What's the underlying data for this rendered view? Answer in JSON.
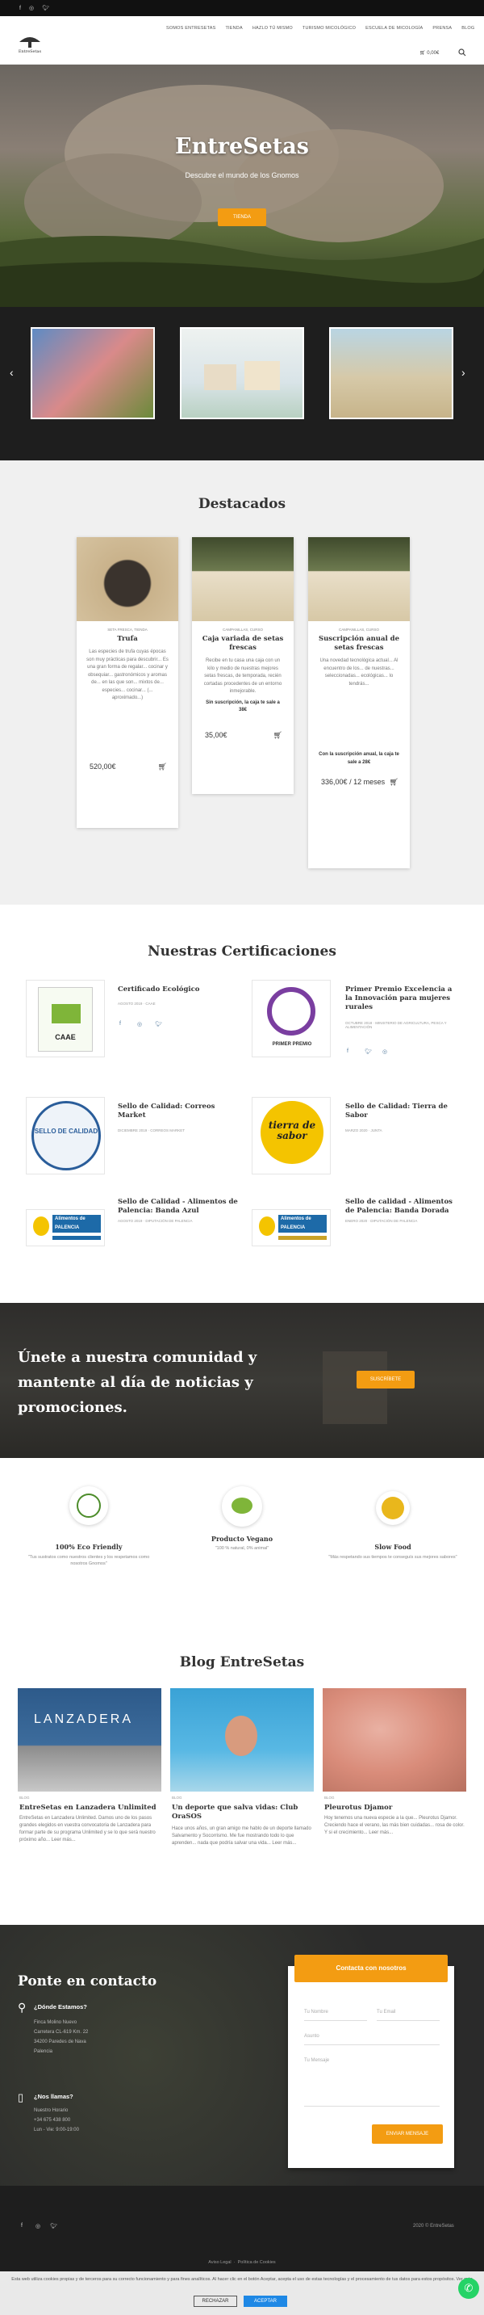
{
  "header": {
    "nav": [
      "SOMOS ENTRESETAS",
      "TIENDA",
      "HAZLO TÚ MISMO",
      "TURISMO MICOLÓGICO",
      "ESCUELA DE MICOLOGÍA",
      "PRENSA",
      "BLOG"
    ],
    "cart": "0,00€"
  },
  "hero": {
    "title": "EntreSetas",
    "subtitle": "Descubre el mundo de los Gnomos",
    "button": "TIENDA"
  },
  "featured": {
    "heading": "Destacados",
    "products": [
      {
        "category": "SETA FRESCA, TIENDA",
        "title": "Trufa",
        "description": "Las especies de trufa cuyas épocas son muy prácticas para descubrir... Es una gran forma de regalar... cocinar y obsequiar... gastronómicos y aromas de... en las que son... mixtos de... especies... cocinar... (... aproximado...)",
        "price": "520,00€"
      },
      {
        "category": "CAMPANILLAS, CURSO",
        "title": "Caja variada de setas frescas",
        "description": "Recibe en tu casa una caja con un kilo y medio de nuestras mejores setas frescas, de temporada, recién cortadas procedentes de un entorno inmejorable.",
        "note": "Sin suscripción, la caja te sale a 38€",
        "price": "35,00€"
      },
      {
        "category": "CAMPANILLAS, CURSO",
        "title": "Suscripción anual de setas frescas",
        "description": "Una novedad tecnológica actual... Al encuentro de los... de nuestras... seleccionadas... ecológicas... lo tendrás...",
        "note": "Con la suscripción anual, la caja te sale a 28€",
        "price": "336,00€",
        "period": "/ 12 meses"
      }
    ]
  },
  "certifications": {
    "heading": "Nuestras Certificaciones",
    "items": [
      {
        "title": "Certificado Ecológico",
        "meta": "AGOSTO 2019 · CAAE",
        "logo": "CAAE"
      },
      {
        "title": "Primer Premio Excelencia a la Innovación para mujeres rurales",
        "meta": "OCTUBRE 2018 · MINISTERIO DE AGRICULTURA, PESCA Y ALIMENTACIÓN",
        "logo": "PRIMER PREMIO"
      },
      {
        "title": "Sello de Calidad: Correos Market",
        "meta": "DICIEMBRE 2019 · CORREOS MARKET",
        "logo": "SELLO DE CALIDAD"
      },
      {
        "title": "Sello de Calidad: Tierra de Sabor",
        "meta": "MARZO 2020 · JUNTA",
        "logo": "tierra de sabor"
      },
      {
        "title": "Sello de Calidad - Alimentos de Palencia: Banda Azul",
        "meta": "AGOSTO 2019 · DIPUTACIÓN DE PALENCIA",
        "logo": "Alimentos de PALENCIA"
      },
      {
        "title": "Sello de calidad - Alimentos de Palencia: Banda Dorada",
        "meta": "ENERO 2020 · DIPUTACIÓN DE PALENCIA",
        "logo": "Alimentos de PALENCIA"
      }
    ]
  },
  "newsletter": {
    "text": "Únete a nuestra comunidad y mantente al día de noticias y promociones.",
    "button": "SUSCRÍBETE"
  },
  "badges": [
    {
      "title": "100% Eco Friendly",
      "description": "\"Tus sustratos como nuestros clientes y los respetamos como nosotros Gnomos\""
    },
    {
      "title": "Producto Vegano",
      "description": "\"100 % natural, 0% animal\""
    },
    {
      "title": "Slow Food",
      "description": "\"Más respetando sus tiempos te conseguís sus mejores sabores\""
    }
  ],
  "blog": {
    "heading": "Blog EntreSetas",
    "posts": [
      {
        "category": "BLOG",
        "title": "EntreSetas en Lanzadera Unlimited",
        "excerpt": "EntreSetas en Lanzadera Unlimited. Damos uno de los pasos grandes elegidos en vuestra convocatoria de Lanzadera para formar parte de su programa Unlimited y se lo que será nuestro próximo año... Leer más..."
      },
      {
        "category": "BLOG",
        "title": "Un deporte que salva vidas: Club OraSOS",
        "excerpt": "Hace unos años, un gran amigo me hablo de un deporte llamado Salvamento y Socorrismo. Me fue mostrando todo lo que aprenden... nada que podría salvar una vida... Leer más..."
      },
      {
        "category": "BLOG",
        "title": "Pleurotus Djamor",
        "excerpt": "Hoy tenemos una nueva especie a la que... Pleurotus Djamor. Creciendo hace el verano, las más bien cuidadas... rosa de color. Y si el crecimiento... Leer más..."
      }
    ]
  },
  "contact": {
    "heading": "Ponte en contacto",
    "where_label": "¿Dónde Estamos?",
    "address": [
      "Finca Molino Nuevo",
      "Carretera CL-619 Km. 22",
      "34200 Paredes de Nava",
      "Palencia"
    ],
    "call_label": "¿Nos llamas?",
    "phone_name": "Nuestro Horario",
    "phone": "+34 675 438 800",
    "hours": "Lun - Vie: 9:00-19:00",
    "form_title": "Contacta con nosotros",
    "name_ph": "Tu Nombre",
    "email_ph": "Tu Email",
    "subject_ph": "Asunto",
    "message_ph": "Tu Mensaje",
    "send": "ENVIAR MENSAJE"
  },
  "footer": {
    "links": [
      "Aviso Legal",
      "Política de Cookies"
    ],
    "copyright": "2020 © EntreSetas"
  },
  "cookie": {
    "text": "Esta web utiliza cookies propias y de terceros para su correcto funcionamiento y para fines analíticos. Al hacer clic en el botón Aceptar, acepta el uso de estas tecnologías y el procesamiento de tus datos para estos propósitos. Ver más",
    "reject": "RECHAZAR",
    "accept": "ACEPTAR"
  },
  "colors": {
    "accent": "#f39c12",
    "dark": "#1e1e1e",
    "whatsapp": "#25d366",
    "cookie_accept": "#1e88e5"
  }
}
